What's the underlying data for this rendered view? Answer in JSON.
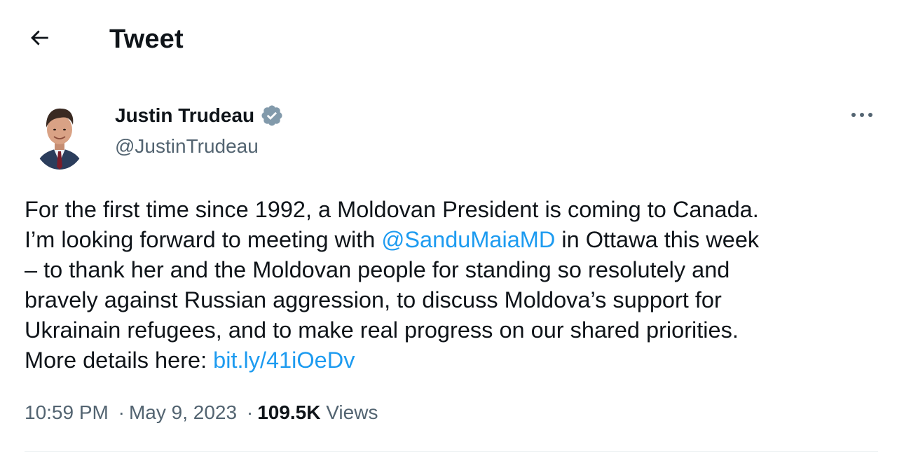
{
  "header": {
    "title": "Tweet",
    "back_icon": "arrow-left-icon"
  },
  "author": {
    "name": "Justin Trudeau",
    "handle": "@JustinTrudeau",
    "verified_color": "#829aab",
    "avatar_icon": "profile-photo"
  },
  "more_icon": "more-dots-icon",
  "tweet": {
    "line1": "For the first time since 1992, a Moldovan President is coming to Canada.",
    "line2_prefix": "I’m looking forward to meeting with ",
    "mention": "@SanduMaiaMD",
    "line2_suffix": " in Ottawa this week",
    "line3": "– to thank her and the Moldovan people for standing so resolutely and",
    "line4": "bravely against Russian aggression, to discuss Moldova’s support for",
    "line5": "Ukrainain refugees, and to make real progress on our shared priorities.",
    "line6_prefix": "More details here: ",
    "link": "bit.ly/41iOeDv"
  },
  "meta": {
    "time": "10:59 PM",
    "dot1": "·",
    "date": "May 9, 2023",
    "dot2": "·",
    "views_count": "109.5K",
    "views_label": "Views"
  },
  "colors": {
    "link": "#1d9bf0",
    "secondary_text": "#536471",
    "primary_text": "#0f1419"
  }
}
